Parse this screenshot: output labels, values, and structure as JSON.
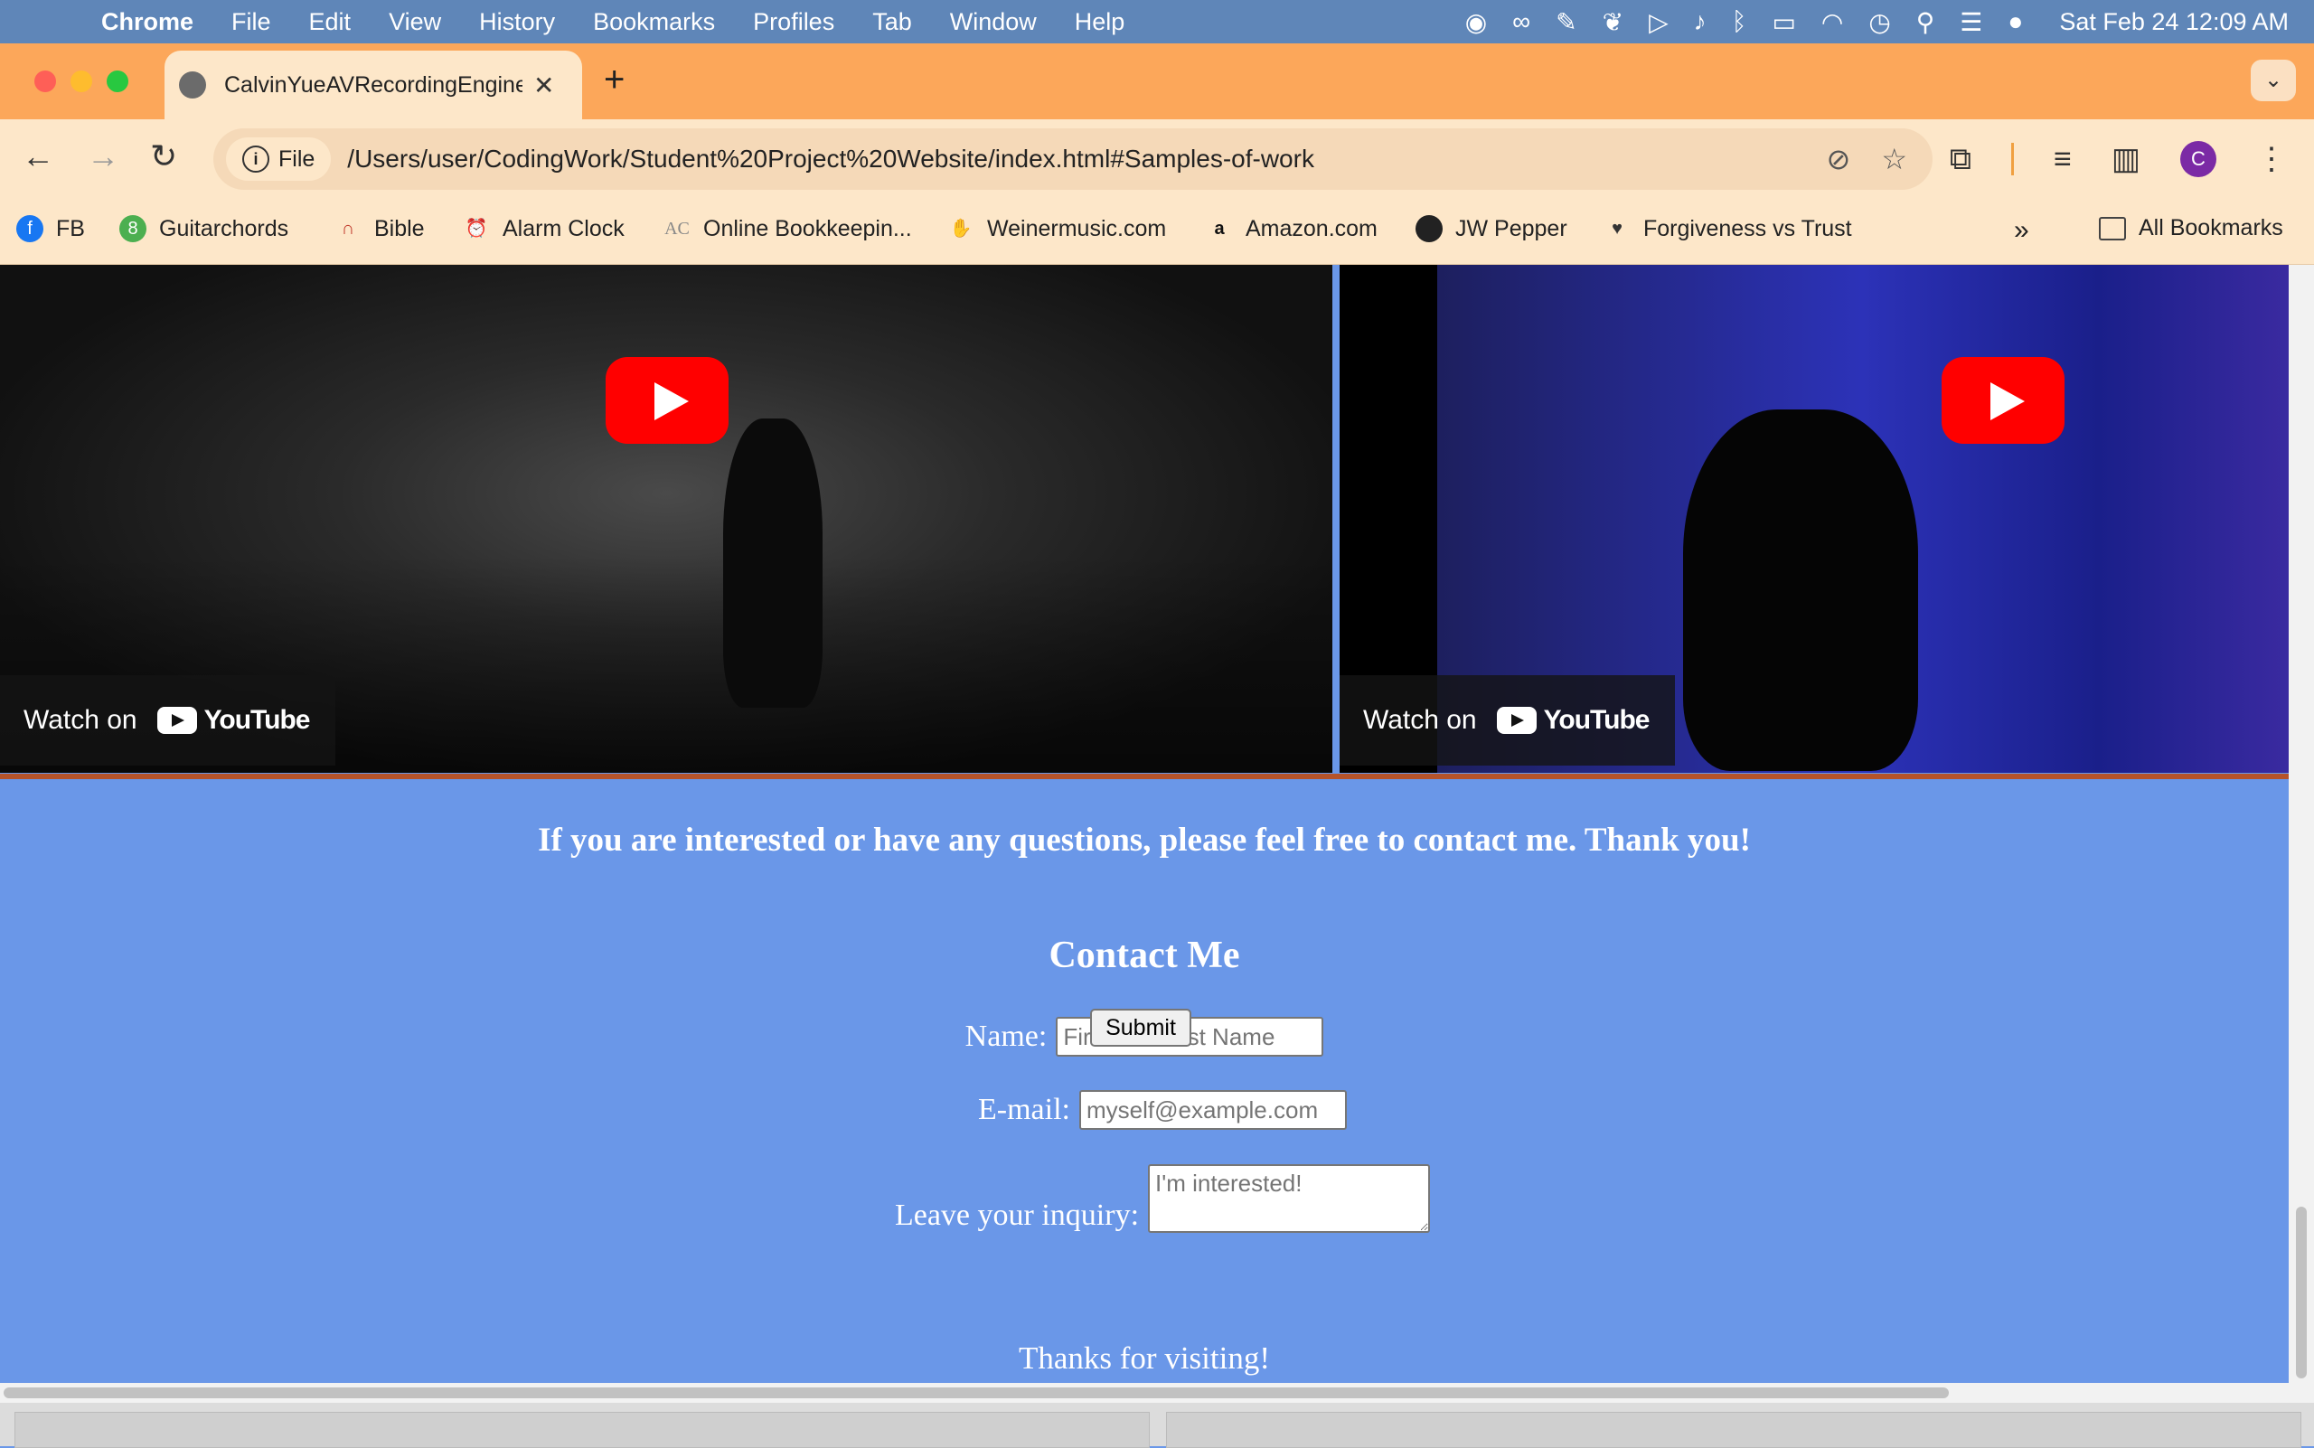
{
  "menubar": {
    "app_name": "Chrome",
    "menus": [
      "File",
      "Edit",
      "View",
      "History",
      "Bookmarks",
      "Profiles",
      "Tab",
      "Window",
      "Help"
    ],
    "clock": "Sat Feb 24  12:09 AM"
  },
  "tab": {
    "title": "CalvinYueAVRecordingEngine",
    "new_tab": "+",
    "menu": "⌄"
  },
  "omnibox": {
    "chip": "File",
    "url": "/Users/user/CodingWork/Student%20Project%20Website/index.html#Samples-of-work"
  },
  "profile_initial": "C",
  "bookmarks": {
    "items": [
      {
        "label": "FB",
        "icon": "facebook-icon",
        "color": "#1877f2"
      },
      {
        "label": "Guitarchords",
        "icon": "guitarchords-icon",
        "color": "#4caf50"
      },
      {
        "label": "Bible",
        "icon": "bible-icon",
        "color": "#c0392b"
      },
      {
        "label": "Alarm Clock",
        "icon": "alarm-clock-icon",
        "color": "#d32f2f"
      },
      {
        "label": "Online Bookkeepin...",
        "icon": "bookkeeping-icon",
        "color": "#888888"
      },
      {
        "label": "Weinermusic.com",
        "icon": "weinermusic-icon",
        "color": "#555555"
      },
      {
        "label": "Amazon.com",
        "icon": "amazon-icon",
        "color": "#111111"
      },
      {
        "label": "JW Pepper",
        "icon": "jwpepper-icon",
        "color": "#222222"
      },
      {
        "label": "Forgiveness vs Trust",
        "icon": "heart-icon",
        "color": "#333333"
      }
    ],
    "overflow": "»",
    "all_bookmarks": "All Bookmarks"
  },
  "videos": [
    {
      "watch_label": "Watch on",
      "brand": "YouTube"
    },
    {
      "watch_label": "Watch on",
      "brand": "YouTube"
    }
  ],
  "content": {
    "interest": "If you are interested or have any questions, please feel free to contact me. Thank you!",
    "contact_title": "Contact Me",
    "name_label": "Name:",
    "name_placeholder": "First and Last Name",
    "email_label": "E-mail:",
    "email_placeholder": "myself@example.com",
    "inquiry_label": "Leave your inquiry:",
    "inquiry_placeholder": "I'm interested!",
    "submit_label": "Submit",
    "thanks": "Thanks for visiting!"
  }
}
